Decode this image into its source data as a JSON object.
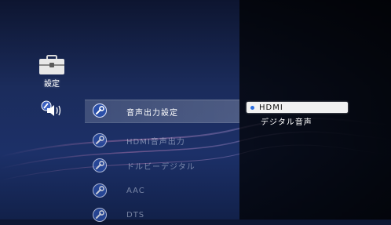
{
  "categories": {
    "settings_label": "設定"
  },
  "settings_items": [
    {
      "label": "音声出力設定",
      "selected": true
    },
    {
      "label": "HDMI音声出力"
    },
    {
      "label": "ドルビーデジタル"
    },
    {
      "label": "AAC"
    },
    {
      "label": "DTS"
    }
  ],
  "options": [
    {
      "label": "HDMI",
      "active": true
    },
    {
      "label": "デジタル音声"
    }
  ],
  "colors": {
    "background": "#1b2c5c",
    "option_highlight": "#f1f1f1",
    "radio_dot": "#2a6de0"
  }
}
